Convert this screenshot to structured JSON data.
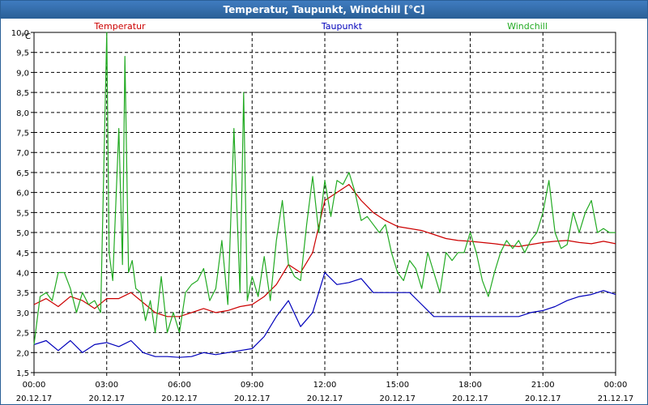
{
  "window": {
    "title": "Temperatur, Taupunkt, Windchill [°C]"
  },
  "colors": {
    "temperatur": "#cc0000",
    "taupunkt": "#0000bb",
    "windchill": "#22aa22",
    "grid": "#000000",
    "titlebar": "#2a5f96"
  },
  "chart_data": {
    "type": "line",
    "title": "Temperatur, Taupunkt, Windchill [°C]",
    "ylabel": "°C",
    "xlabel": "",
    "ylim": [
      1.5,
      10.0
    ],
    "xlim": [
      0,
      24
    ],
    "grid": true,
    "legend_placement": "top",
    "y_ticks": [
      "1,5",
      "2,0",
      "2,5",
      "3,0",
      "3,5",
      "4,0",
      "4,5",
      "5,0",
      "5,5",
      "6,0",
      "6,5",
      "7,0",
      "7,5",
      "8,0",
      "8,5",
      "9,0",
      "9,5",
      "10,0"
    ],
    "x_ticks": [
      {
        "time": "00:00",
        "date": "20.12.17"
      },
      {
        "time": "03:00",
        "date": "20.12.17"
      },
      {
        "time": "06:00",
        "date": "20.12.17"
      },
      {
        "time": "09:00",
        "date": "20.12.17"
      },
      {
        "time": "12:00",
        "date": "20.12.17"
      },
      {
        "time": "15:00",
        "date": "20.12.17"
      },
      {
        "time": "18:00",
        "date": "20.12.17"
      },
      {
        "time": "21:00",
        "date": "20.12.17"
      },
      {
        "time": "00:00",
        "date": "21.12.17"
      }
    ],
    "series": [
      {
        "name": "Temperatur",
        "color": "#cc0000",
        "x": [
          0,
          0.5,
          1,
          1.5,
          2,
          2.5,
          3,
          3.5,
          4,
          4.5,
          5,
          5.5,
          6,
          6.5,
          7,
          7.5,
          8,
          8.5,
          9,
          9.5,
          10,
          10.5,
          11,
          11.5,
          12,
          12.5,
          13,
          13.5,
          14,
          14.5,
          15,
          15.5,
          16,
          16.5,
          17,
          17.5,
          18,
          18.5,
          19,
          19.5,
          20,
          20.5,
          21,
          21.5,
          22,
          22.5,
          23,
          23.5,
          24
        ],
        "values": [
          3.2,
          3.35,
          3.15,
          3.4,
          3.3,
          3.1,
          3.35,
          3.35,
          3.5,
          3.25,
          3.0,
          2.9,
          2.9,
          3.0,
          3.1,
          3.0,
          3.05,
          3.15,
          3.2,
          3.4,
          3.7,
          4.2,
          4.0,
          4.5,
          5.8,
          6.0,
          6.2,
          5.8,
          5.5,
          5.3,
          5.15,
          5.1,
          5.05,
          4.95,
          4.85,
          4.8,
          4.78,
          4.75,
          4.72,
          4.68,
          4.65,
          4.7,
          4.75,
          4.78,
          4.8,
          4.75,
          4.72,
          4.78,
          4.72
        ]
      },
      {
        "name": "Taupunkt",
        "color": "#0000bb",
        "x": [
          0,
          0.5,
          1,
          1.5,
          2,
          2.5,
          3,
          3.5,
          4,
          4.5,
          5,
          5.5,
          6,
          6.5,
          7,
          7.5,
          8,
          8.5,
          9,
          9.5,
          10,
          10.5,
          11,
          11.5,
          12,
          12.5,
          13,
          13.5,
          14,
          14.5,
          15,
          15.5,
          16,
          16.5,
          17,
          17.5,
          18,
          18.5,
          19,
          19.5,
          20,
          20.5,
          21,
          21.5,
          22,
          22.5,
          23,
          23.5,
          24
        ],
        "values": [
          2.2,
          2.3,
          2.05,
          2.3,
          2.0,
          2.2,
          2.25,
          2.15,
          2.3,
          2.0,
          1.9,
          1.9,
          1.88,
          1.9,
          2.0,
          1.95,
          2.0,
          2.05,
          2.1,
          2.4,
          2.9,
          3.3,
          2.65,
          3.0,
          4.0,
          3.7,
          3.75,
          3.85,
          3.5,
          3.5,
          3.5,
          3.5,
          3.2,
          2.9,
          2.9,
          2.9,
          2.9,
          2.9,
          2.9,
          2.9,
          2.9,
          3.0,
          3.05,
          3.15,
          3.3,
          3.4,
          3.45,
          3.55,
          3.45
        ]
      },
      {
        "name": "Windchill",
        "color": "#22aa22",
        "x": [
          0,
          0.25,
          0.5,
          0.75,
          1,
          1.25,
          1.5,
          1.75,
          2,
          2.25,
          2.5,
          2.75,
          3,
          3.1,
          3.25,
          3.5,
          3.65,
          3.75,
          3.9,
          4.05,
          4.2,
          4.4,
          4.6,
          4.8,
          5,
          5.25,
          5.5,
          5.75,
          6,
          6.25,
          6.5,
          6.75,
          7,
          7.25,
          7.5,
          7.75,
          8,
          8.25,
          8.5,
          8.65,
          8.8,
          9,
          9.25,
          9.5,
          9.75,
          10,
          10.25,
          10.5,
          10.75,
          11,
          11.25,
          11.5,
          11.75,
          12,
          12.25,
          12.5,
          12.75,
          13,
          13.25,
          13.5,
          13.75,
          14,
          14.25,
          14.5,
          14.75,
          15,
          15.25,
          15.5,
          15.75,
          16,
          16.25,
          16.5,
          16.75,
          17,
          17.25,
          17.5,
          17.75,
          18,
          18.25,
          18.5,
          18.75,
          19,
          19.25,
          19.5,
          19.75,
          20,
          20.25,
          20.5,
          20.75,
          21,
          21.25,
          21.5,
          21.75,
          22,
          22.25,
          22.5,
          22.75,
          23,
          23.25,
          23.5,
          23.75,
          24
        ],
        "values": [
          2.2,
          3.4,
          3.5,
          3.3,
          4.0,
          4.0,
          3.6,
          3.0,
          3.5,
          3.2,
          3.3,
          3.0,
          10.0,
          4.5,
          3.8,
          7.6,
          4.2,
          9.4,
          4.0,
          4.3,
          3.6,
          3.5,
          2.8,
          3.3,
          2.5,
          3.9,
          2.5,
          3.0,
          2.5,
          3.5,
          3.7,
          3.8,
          4.1,
          3.3,
          3.6,
          4.8,
          3.2,
          7.6,
          3.5,
          8.5,
          3.3,
          3.9,
          3.4,
          4.4,
          3.3,
          4.8,
          5.8,
          4.2,
          3.9,
          3.8,
          5.2,
          6.4,
          5.0,
          6.3,
          5.4,
          6.3,
          6.2,
          6.5,
          6.0,
          5.3,
          5.4,
          5.2,
          5.0,
          5.2,
          4.5,
          4.0,
          3.8,
          4.3,
          4.1,
          3.6,
          4.5,
          4.0,
          3.5,
          4.5,
          4.3,
          4.5,
          4.5,
          5.0,
          4.5,
          3.8,
          3.4,
          4.0,
          4.5,
          4.8,
          4.6,
          4.8,
          4.5,
          4.8,
          5.0,
          5.5,
          6.3,
          5.0,
          4.6,
          4.7,
          5.5,
          5.0,
          5.5,
          5.8,
          5.0,
          5.1,
          5.0,
          5.0
        ]
      }
    ]
  }
}
